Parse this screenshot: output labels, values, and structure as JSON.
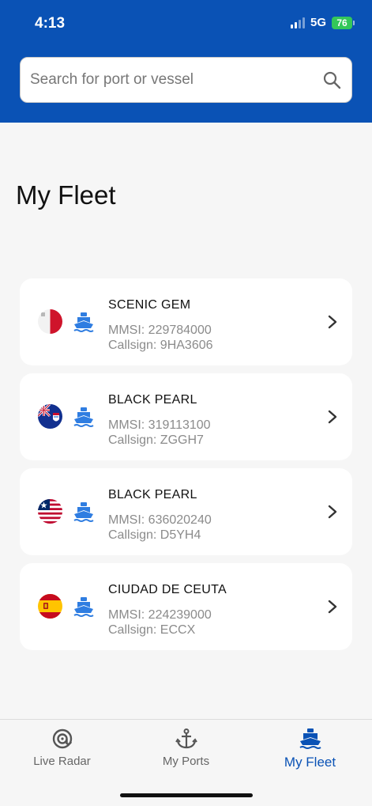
{
  "status_bar": {
    "time": "4:13",
    "network": "5G",
    "battery": "76"
  },
  "search": {
    "placeholder": "Search for port or vessel",
    "value": ""
  },
  "page_title": "My Fleet",
  "vessels": [
    {
      "name": "SCENIC GEM",
      "mmsi": "MMSI: 229784000",
      "callsign": "Callsign: 9HA3606",
      "flag": "malta-flag-icon"
    },
    {
      "name": "BLACK PEARL",
      "mmsi": "MMSI: 319113100",
      "callsign": "Callsign: ZGGH7",
      "flag": "cayman-islands-flag-icon"
    },
    {
      "name": "BLACK PEARL",
      "mmsi": "MMSI: 636020240",
      "callsign": "Callsign: D5YH4",
      "flag": "liberia-flag-icon"
    },
    {
      "name": "CIUDAD DE CEUTA",
      "mmsi": "MMSI: 224239000",
      "callsign": "Callsign: ECCX",
      "flag": "spain-flag-icon"
    }
  ],
  "tabs": [
    {
      "label": "Live Radar",
      "icon": "radar-icon",
      "active": false
    },
    {
      "label": "My Ports",
      "icon": "anchor-icon",
      "active": false
    },
    {
      "label": "My Fleet",
      "icon": "ship-icon",
      "active": true
    }
  ],
  "colors": {
    "header": "#0a52b5",
    "accent": "#0a52b5",
    "ship_icon": "#2f7de1",
    "battery": "#34c759"
  }
}
